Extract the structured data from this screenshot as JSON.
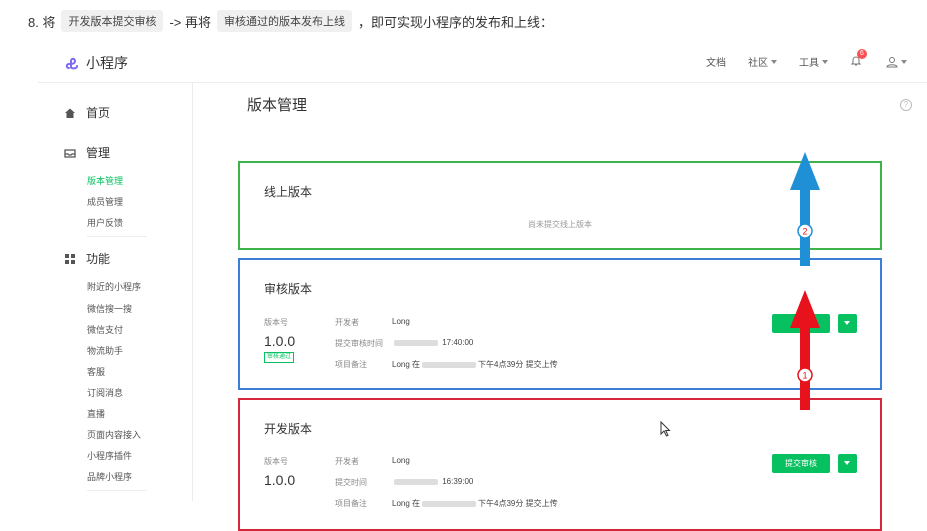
{
  "intro": {
    "prefix": "8. 将",
    "code1": "开发版本提交审核",
    "mid": "-> 再将",
    "code2": "审核通过的版本发布上线",
    "suffix": "，即可实现小程序的发布和上线："
  },
  "app": {
    "name": "小程序"
  },
  "topnav": {
    "docs": "文档",
    "community": "社区",
    "tools": "工具",
    "notifications": "6"
  },
  "sidebar": {
    "home": "首页",
    "manage": "管理",
    "manage_items": [
      "版本管理",
      "成员管理",
      "用户反馈"
    ],
    "features": "功能",
    "feature_items": [
      "附近的小程序",
      "微信搜一搜",
      "微信支付",
      "物流助手",
      "客服",
      "订阅消息",
      "直播",
      "页面内容接入",
      "小程序插件",
      "品牌小程序"
    ]
  },
  "main": {
    "title": "版本管理",
    "help": "?",
    "online": {
      "title": "线上版本",
      "empty": "尚未提交线上版本"
    },
    "review": {
      "title": "审核版本",
      "version_label": "版本号",
      "version": "1.0.0",
      "status_tag": "审核通过",
      "developer_label": "开发者",
      "developer": "Long",
      "submit_label": "提交审核时间",
      "submit_time": "17:40:00",
      "note_label": "项目备注",
      "note_prefix": "Long 在",
      "note_suffix": "下午4点39分 提交上传",
      "publish_button": "发布"
    },
    "dev": {
      "title": "开发版本",
      "version_label": "版本号",
      "version": "1.0.0",
      "developer_label": "开发者",
      "developer": "Long",
      "submit_label": "提交时间",
      "submit_time": "16:39:00",
      "note_label": "项目备注",
      "note_prefix": "Long 在",
      "note_suffix": "下午4点39分 提交上传",
      "submit_button": "提交审核"
    }
  },
  "annotations": {
    "step1": "1",
    "step2": "2"
  },
  "colors": {
    "accent": "#07c160",
    "green_box": "#3db34a",
    "blue_box": "#3a7fd5",
    "red_box": "#d6263a",
    "arrow_red": "#e8121c",
    "arrow_blue": "#1f8fd6"
  }
}
